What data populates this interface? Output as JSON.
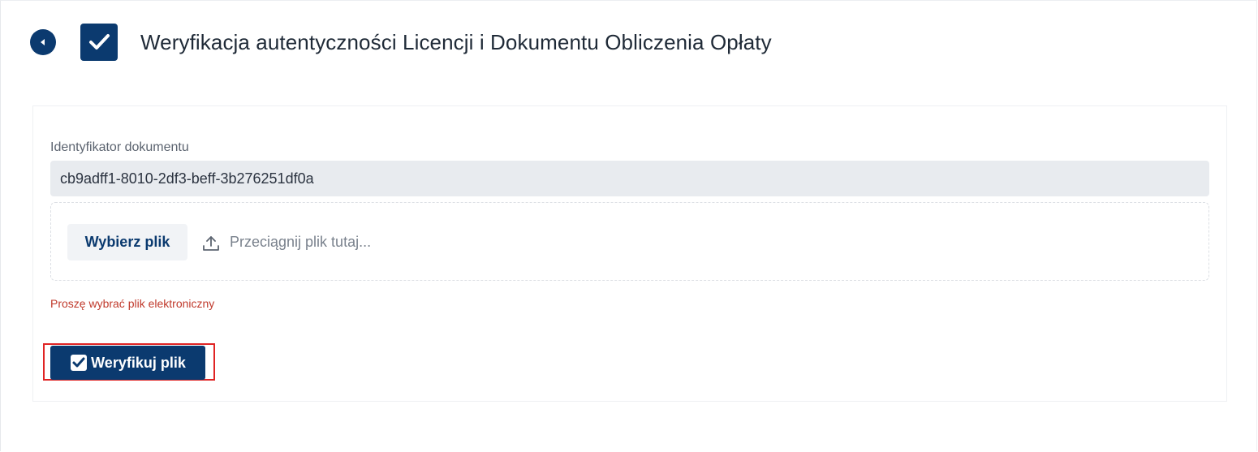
{
  "header": {
    "title": "Weryfikacja autentyczności Licencji i Dokumentu Obliczenia Opłaty",
    "back_icon": "back-arrow-circle-icon",
    "tile_icon": "checkmark-icon"
  },
  "form": {
    "id_label": "Identyfikator dokumentu",
    "id_value": "cb9adff1-8010-2df3-beff-3b276251df0a",
    "file": {
      "choose_label": "Wybierz plik",
      "drop_hint": "Przeciągnij plik tutaj...",
      "upload_icon": "upload-icon"
    },
    "error": "Proszę wybrać plik elektroniczny",
    "verify_label": "Weryfikuj plik",
    "verify_icon": "checkbox-checked-icon"
  },
  "colors": {
    "primary": "#0b3a6f",
    "error": "#c0392b",
    "highlight": "#e02424",
    "input_bg": "#e8ebef"
  }
}
